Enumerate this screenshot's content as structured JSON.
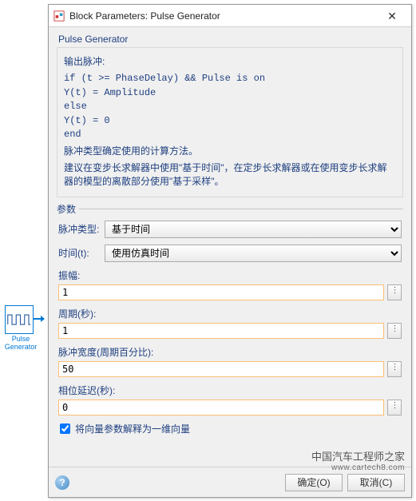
{
  "block": {
    "name": "Pulse\nGenerator"
  },
  "dialog": {
    "title": "Block Parameters: Pulse Generator",
    "section_title": "Pulse Generator",
    "description": {
      "line1": "输出脉冲:",
      "code": "if (t >= PhaseDelay) && Pulse is on\nY(t) = Amplitude\nelse\nY(t) = 0\nend",
      "line2": "脉冲类型确定使用的计算方法。",
      "line3": "建议在变步长求解器中使用\"基于时间\"，在定步长求解器或在使用变步长求解器的模型的离散部分使用\"基于采样\"。"
    },
    "params_header": "参数",
    "pulse_type_label": "脉冲类型:",
    "pulse_type_value": "基于时间",
    "time_label": "时间(t):",
    "time_value": "使用仿真时间",
    "amplitude_label": "振幅:",
    "amplitude_value": "1",
    "period_label": "周期(秒):",
    "period_value": "1",
    "pulsewidth_label": "脉冲宽度(周期百分比):",
    "pulsewidth_value": "50",
    "phasedelay_label": "相位延迟(秒):",
    "phasedelay_value": "0",
    "checkbox_label": "将向量参数解释为一维向量",
    "checkbox_checked": true,
    "dots": "⋮",
    "buttons": {
      "ok": "确定(O)",
      "cancel": "取消(C)",
      "help": "?"
    }
  },
  "watermark": {
    "line1": "中国汽车工程师之家",
    "line2": "www.cartech8.com"
  }
}
